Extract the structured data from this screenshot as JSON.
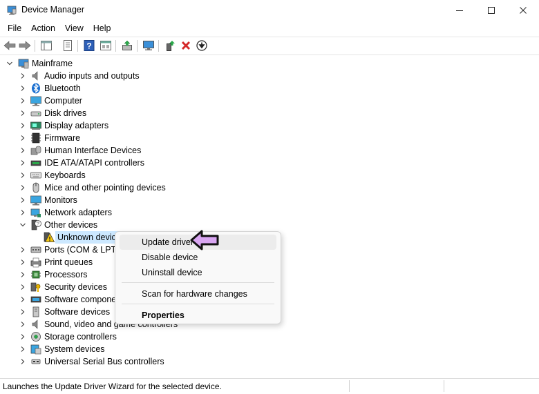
{
  "window": {
    "title": "Device Manager"
  },
  "menu": {
    "file": "File",
    "action": "Action",
    "view": "View",
    "help": "Help"
  },
  "toolbar": {
    "icons": [
      "back-icon",
      "forward-icon",
      "show-hide-tree-icon",
      "properties-icon",
      "help-icon",
      "view-icon",
      "update-driver-icon",
      "scan-hardware-icon",
      "enable-device-icon",
      "uninstall-icon",
      "download-icon"
    ]
  },
  "tree": {
    "root": "Mainframe",
    "categories": [
      "Audio inputs and outputs",
      "Bluetooth",
      "Computer",
      "Disk drives",
      "Display adapters",
      "Firmware",
      "Human Interface Devices",
      "IDE ATA/ATAPI controllers",
      "Keyboards",
      "Mice and other pointing devices",
      "Monitors",
      "Network adapters",
      "Other devices",
      "Unknown device",
      "Ports (COM & LPT)",
      "Print queues",
      "Processors",
      "Security devices",
      "Software components",
      "Software devices",
      "Sound, video and game controllers",
      "Storage controllers",
      "System devices",
      "Universal Serial Bus controllers"
    ]
  },
  "context_menu": {
    "update_driver": "Update driver",
    "disable_device": "Disable device",
    "uninstall_device": "Uninstall device",
    "scan": "Scan for hardware changes",
    "properties": "Properties"
  },
  "status": {
    "text": "Launches the Update Driver Wizard for the selected device."
  },
  "colors": {
    "selection": "#cce8ff",
    "cursor_fill": "#d9a6f2",
    "accent_blue": "#1a6fd0",
    "delete_red": "#d42a2a"
  }
}
